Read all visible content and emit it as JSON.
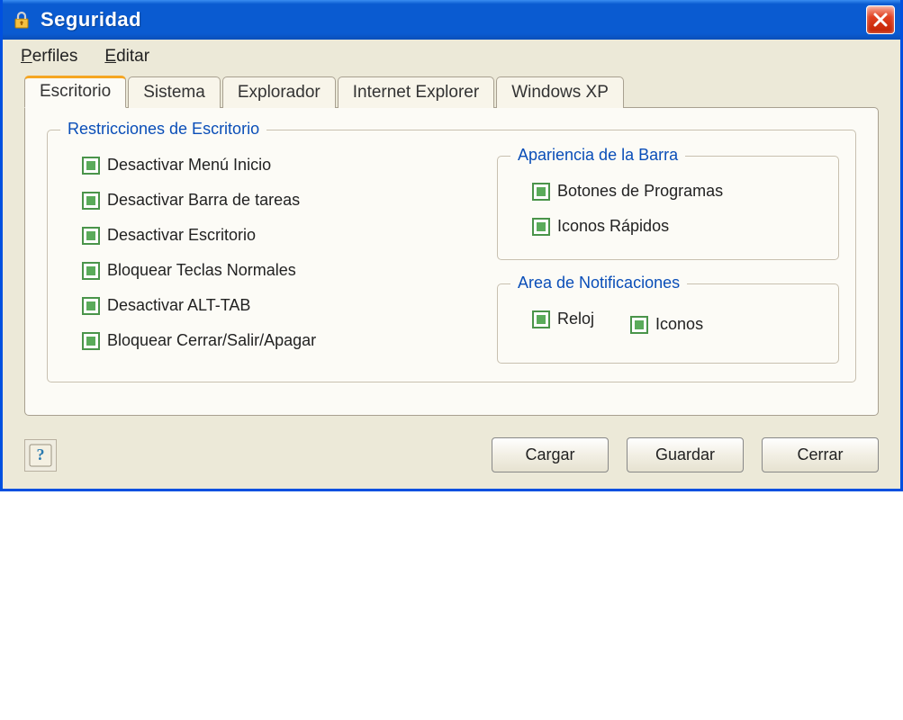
{
  "title": "Seguridad",
  "menu": {
    "perfiles": "Perfiles",
    "editar": "Editar"
  },
  "tabs": {
    "escritorio": "Escritorio",
    "sistema": "Sistema",
    "explorador": "Explorador",
    "ie": "Internet Explorer",
    "xp": "Windows XP"
  },
  "groups": {
    "restricciones": "Restricciones de Escritorio",
    "apariencia": "Apariencia de la Barra",
    "notificaciones": "Area de Notificaciones"
  },
  "checks": {
    "desactivar_menu_inicio": "Desactivar Menú Inicio",
    "desactivar_barra_tareas": "Desactivar Barra de tareas",
    "desactivar_escritorio": "Desactivar Escritorio",
    "bloquear_teclas": "Bloquear Teclas Normales",
    "desactivar_alttab": "Desactivar ALT-TAB",
    "bloquear_cerrar": "Bloquear Cerrar/Salir/Apagar",
    "botones_programas": "Botones de Programas",
    "iconos_rapidos": "Iconos Rápidos",
    "reloj": "Reloj",
    "iconos": "Iconos"
  },
  "buttons": {
    "cargar": "Cargar",
    "guardar": "Guardar",
    "cerrar": "Cerrar"
  }
}
